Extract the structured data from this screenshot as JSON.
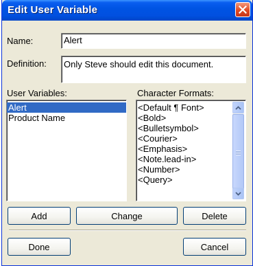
{
  "window": {
    "title": "Edit User Variable",
    "close_icon": "close-icon"
  },
  "form": {
    "name_label": "Name:",
    "name_value": "Alert",
    "definition_label": "Definition:",
    "definition_value": "Only Steve should edit this document."
  },
  "user_variables": {
    "label": "User Variables:",
    "items": [
      "Alert",
      "Product Name"
    ],
    "selected": "Alert"
  },
  "character_formats": {
    "label": "Character Formats:",
    "items": [
      "<Default ¶ Font>",
      "<Bold>",
      "<Bulletsymbol>",
      "<Courier>",
      "<Emphasis>",
      "<Note.lead-in>",
      "<Number>",
      "<Query>"
    ]
  },
  "buttons": {
    "add": "Add",
    "change": "Change",
    "delete": "Delete",
    "done": "Done",
    "cancel": "Cancel"
  },
  "colors": {
    "title_bar": "#0054e3",
    "selection": "#316ac5",
    "dialog_bg": "#ece9d8"
  }
}
